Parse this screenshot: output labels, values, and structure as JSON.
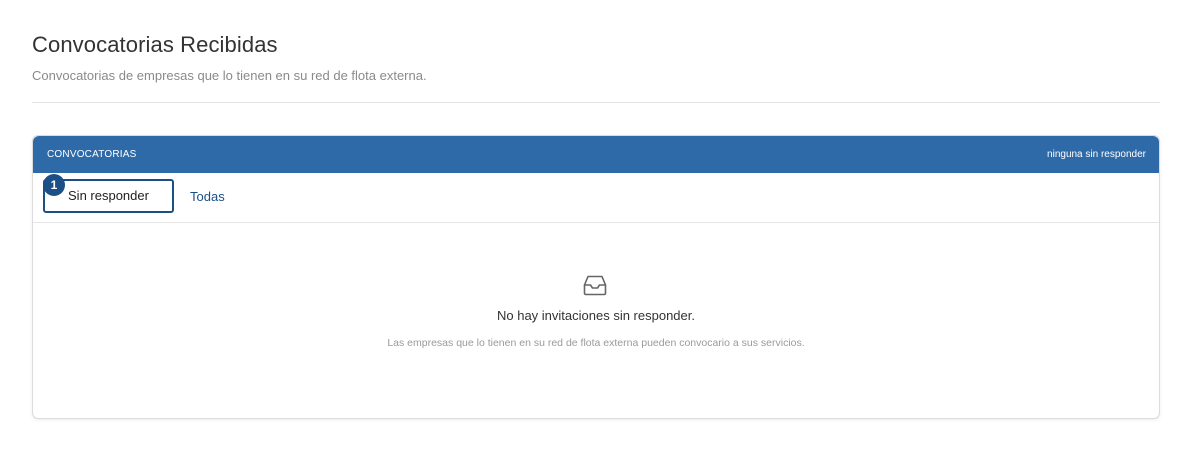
{
  "page": {
    "title": "Convocatorias Recibidas",
    "subtitle": "Convocatorias de empresas que lo tienen en su red de flota externa."
  },
  "panel": {
    "header_title": "CONVOCATORIAS",
    "header_status": "ninguna sin responder",
    "header_color": "#2e6aa8"
  },
  "tabs": [
    {
      "label": "Sin responder",
      "badge": "1",
      "active": true
    },
    {
      "label": "Todas",
      "active": false
    }
  ],
  "empty_state": {
    "icon": "inbox-icon",
    "title": "No hay invitaciones sin responder.",
    "description": "Las empresas que lo tienen en su red de flota externa pueden convocario a sus servicios."
  },
  "colors": {
    "accent": "#1c4f86"
  }
}
